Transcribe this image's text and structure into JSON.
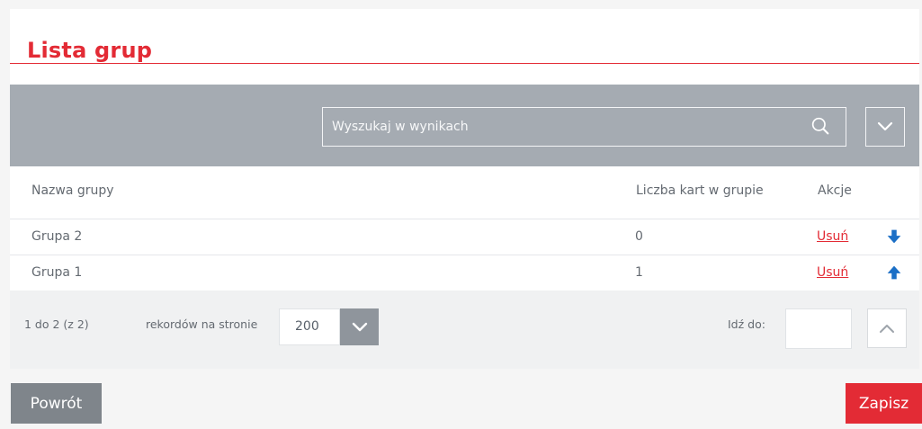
{
  "page": {
    "title": "Lista grup"
  },
  "search": {
    "placeholder": "Wyszukaj w wynikach"
  },
  "table": {
    "headers": [
      "Nazwa grupy",
      "Liczba kart w grupie",
      "Akcje"
    ],
    "rows": [
      {
        "name": "Grupa 2",
        "count": "0",
        "action": "Usuń",
        "move_icon": "arrow-down-icon"
      },
      {
        "name": "Grupa 1",
        "count": "1",
        "action": "Usuń",
        "move_icon": "arrow-up-icon"
      }
    ]
  },
  "pagination": {
    "range": "1 do 2 (z 2)",
    "records_label": "rekordów na stronie",
    "per_page": "200",
    "go_to_label": "Idź do:"
  },
  "buttons": {
    "back": "Powrót",
    "save": "Zapisz"
  },
  "colors": {
    "accent_red": "#e32b35",
    "toolbar_gray": "#a5abb2",
    "action_blue": "#1b6fc6",
    "footer_gray": "#f0f1f2"
  },
  "icons": {
    "search": "search-icon",
    "dropdown": "chevron-down-icon",
    "per_page_dropdown": "chevron-down-icon",
    "page_up": "chevron-up-icon",
    "move_down": "arrow-down-icon",
    "move_up": "arrow-up-icon"
  }
}
